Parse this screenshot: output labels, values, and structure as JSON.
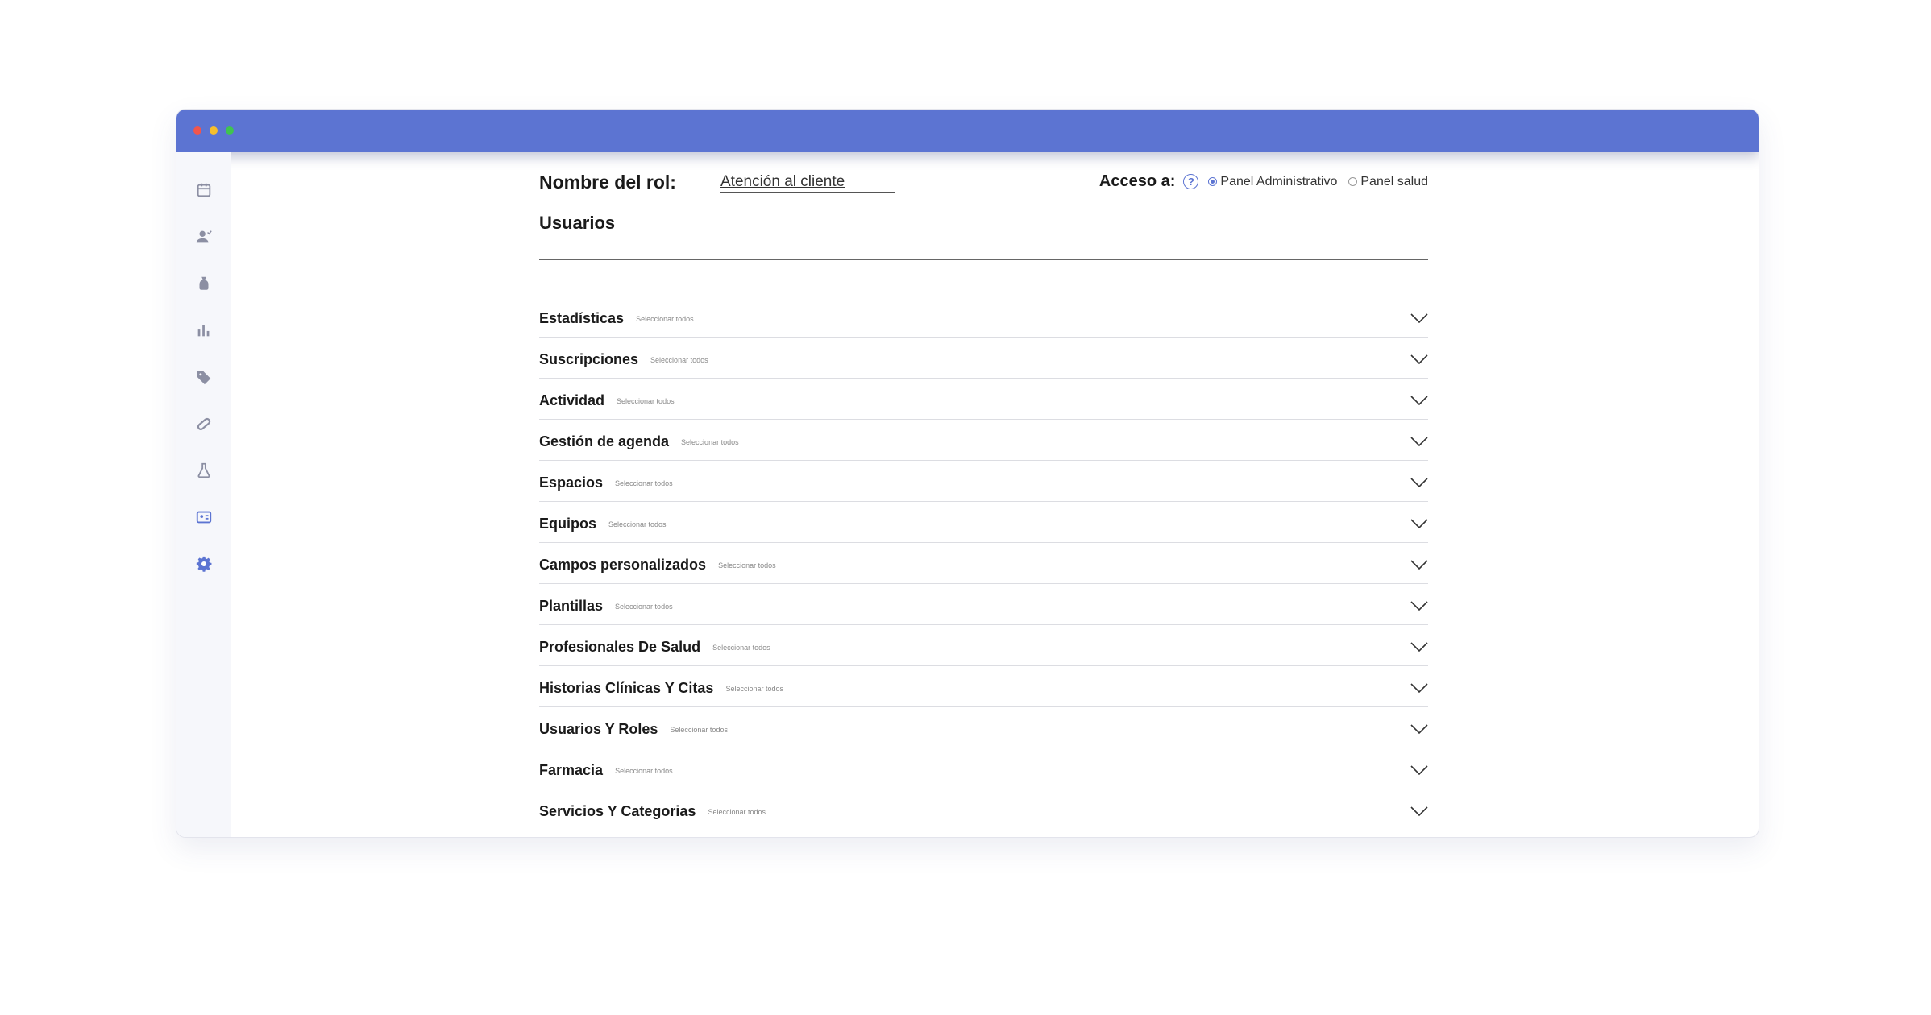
{
  "window": {
    "controls": [
      "close",
      "minimize",
      "maximize"
    ],
    "titlebar_color": "#5c74d2"
  },
  "sidebar": {
    "items": [
      {
        "icon": "calendar-icon"
      },
      {
        "icon": "user-check-icon"
      },
      {
        "icon": "money-bag-icon"
      },
      {
        "icon": "bar-chart-icon"
      },
      {
        "icon": "tag-icon"
      },
      {
        "icon": "pill-icon"
      },
      {
        "icon": "flask-icon"
      },
      {
        "icon": "id-card-icon"
      },
      {
        "icon": "gear-icon",
        "active": true
      }
    ],
    "active_color": "#5c74d2",
    "inactive_color": "#8c8fa3"
  },
  "role": {
    "label": "Nombre del rol:",
    "value": "Atención al cliente"
  },
  "access": {
    "label": "Acceso a:",
    "help": "?",
    "options": [
      {
        "label": "Panel Administrativo",
        "selected": true
      },
      {
        "label": "Panel salud",
        "selected": false
      }
    ]
  },
  "section": {
    "title": "Usuarios"
  },
  "permissions": {
    "select_all_label": "Seleccionar todos",
    "groups": [
      {
        "title": "Estadísticas"
      },
      {
        "title": "Suscripciones"
      },
      {
        "title": "Actividad"
      },
      {
        "title": "Gestión de agenda"
      },
      {
        "title": "Espacios"
      },
      {
        "title": "Equipos"
      },
      {
        "title": "Campos personalizados"
      },
      {
        "title": "Plantillas"
      },
      {
        "title": "Profesionales De Salud"
      },
      {
        "title": "Historias Clínicas Y Citas"
      },
      {
        "title": "Usuarios Y Roles"
      },
      {
        "title": "Farmacia"
      },
      {
        "title": "Servicios Y Categorias"
      }
    ]
  }
}
